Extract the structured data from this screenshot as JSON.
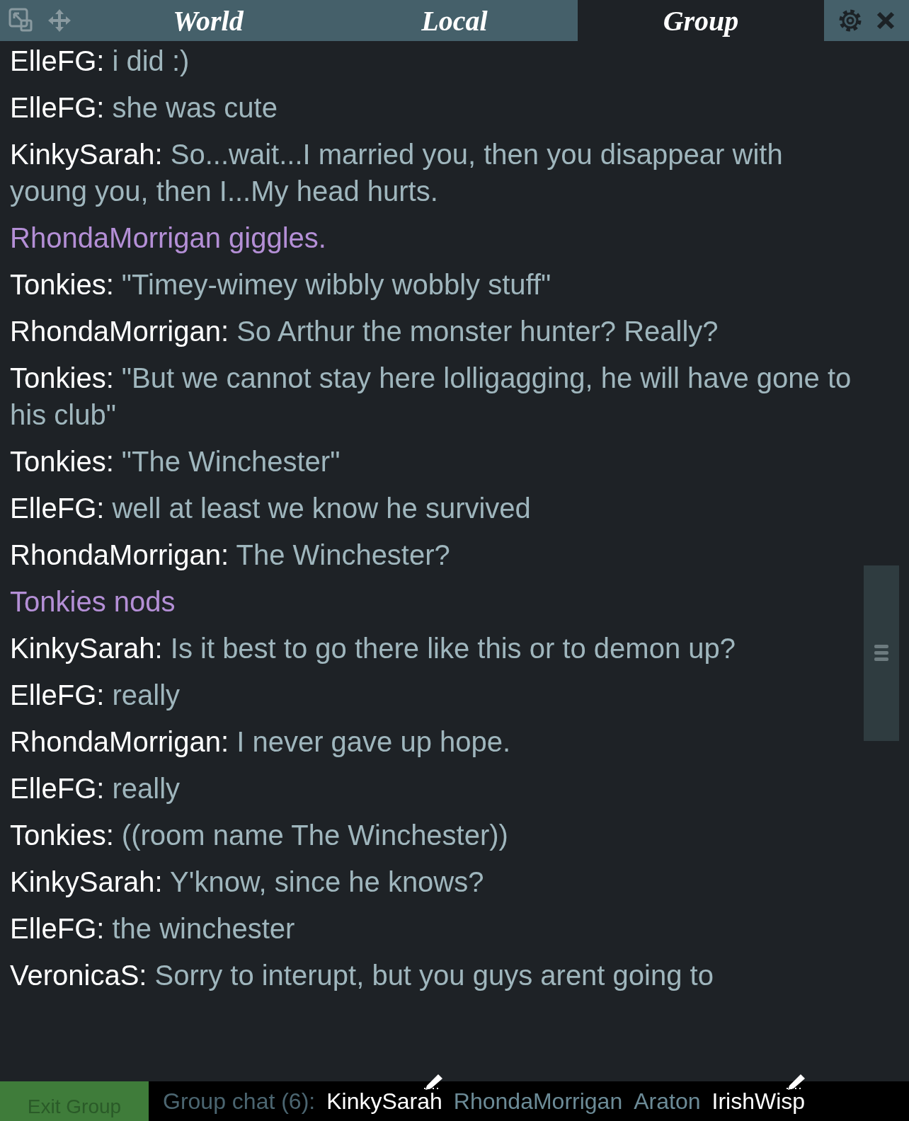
{
  "tabs": [
    {
      "label": "World",
      "selected": false
    },
    {
      "label": "Local",
      "selected": false
    },
    {
      "label": "Group",
      "selected": true
    }
  ],
  "messages": [
    {
      "kind": "say",
      "name": "ElleFG:",
      "text": "i did :)"
    },
    {
      "kind": "say",
      "name": "ElleFG:",
      "text": "she was cute"
    },
    {
      "kind": "say",
      "name": "KinkySarah:",
      "text": "So...wait...I married you, then you disappear with young you, then I...My head hurts."
    },
    {
      "kind": "emote",
      "text": "RhondaMorrigan giggles."
    },
    {
      "kind": "say",
      "name": "Tonkies:",
      "text": "\"Timey-wimey wibbly wobbly stuff\""
    },
    {
      "kind": "say",
      "name": "RhondaMorrigan:",
      "text": "So Arthur the monster hunter?  Really?"
    },
    {
      "kind": "say",
      "name": "Tonkies:",
      "text": "\"But we cannot stay here lolligagging, he will have gone to his club\""
    },
    {
      "kind": "say",
      "name": "Tonkies:",
      "text": "\"The Winchester\""
    },
    {
      "kind": "say",
      "name": "ElleFG:",
      "text": "well at least we know he survived"
    },
    {
      "kind": "say",
      "name": "RhondaMorrigan:",
      "text": "The Winchester?"
    },
    {
      "kind": "emote",
      "text": "Tonkies nods"
    },
    {
      "kind": "say",
      "name": "KinkySarah:",
      "text": "Is it best to go there like this or to demon up?"
    },
    {
      "kind": "say",
      "name": "ElleFG:",
      "text": "really"
    },
    {
      "kind": "say",
      "name": "RhondaMorrigan:",
      "text": "I never gave up hope."
    },
    {
      "kind": "say",
      "name": "ElleFG:",
      "text": "really"
    },
    {
      "kind": "say",
      "name": "Tonkies:",
      "text": "((room name The Winchester))"
    },
    {
      "kind": "say",
      "name": "KinkySarah:",
      "text": "Y'know, since he knows?"
    },
    {
      "kind": "say",
      "name": "ElleFG:",
      "text": "the winchester"
    },
    {
      "kind": "say",
      "name": "VeronicaS:",
      "text": "Sorry to interupt, but you guys arent going to"
    }
  ],
  "footer": {
    "exit_button": "Exit Group",
    "group_label": "Group chat (6):",
    "members": [
      {
        "name": "KinkySarah",
        "typing": true
      },
      {
        "name": "RhondaMorrigan",
        "typing": false
      },
      {
        "name": "Araton",
        "typing": false
      },
      {
        "name": "IrishWisp",
        "typing": true
      }
    ]
  }
}
